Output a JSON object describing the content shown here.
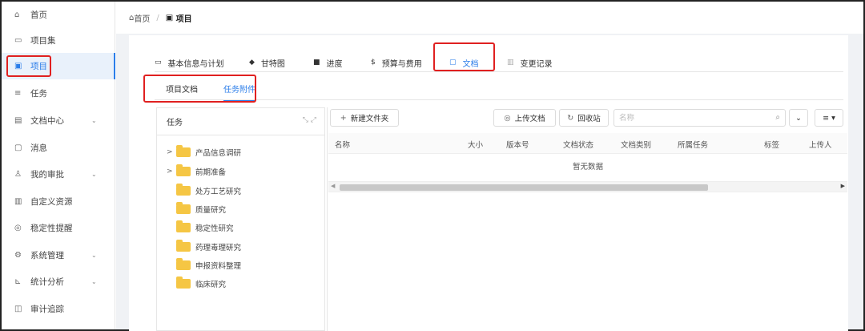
{
  "sidebar": {
    "items": [
      {
        "icon": "home-icon",
        "glyph": "⌂",
        "label": "首页"
      },
      {
        "icon": "folder-collection-icon",
        "glyph": "▭",
        "label": "项目集"
      },
      {
        "icon": "project-icon",
        "glyph": "▣",
        "label": "项目",
        "active": true
      },
      {
        "icon": "list-icon",
        "glyph": "≡",
        "label": "任务"
      },
      {
        "icon": "document-center-icon",
        "glyph": "▤",
        "label": "文档中心",
        "chevron": "⌄"
      },
      {
        "icon": "message-icon",
        "glyph": "▢",
        "label": "消息"
      },
      {
        "icon": "approval-icon",
        "glyph": "♙",
        "label": "我的审批",
        "chevron": "⌄"
      },
      {
        "icon": "custom-resource-icon",
        "glyph": "▥",
        "label": "自定义资源"
      },
      {
        "icon": "stability-reminder-icon",
        "glyph": "◎",
        "label": "稳定性提醒"
      },
      {
        "icon": "settings-icon",
        "glyph": "⚙",
        "label": "系统管理",
        "chevron": "⌄"
      },
      {
        "icon": "chart-icon",
        "glyph": "⊾",
        "label": "统计分析",
        "chevron": "⌄"
      },
      {
        "icon": "audit-icon",
        "glyph": "◫",
        "label": "审计追踪"
      }
    ]
  },
  "breadcrumb": {
    "home": "首页",
    "separator": "/",
    "current": "项目"
  },
  "tabs": [
    {
      "glyph": "▭",
      "label": "基本信息与计划"
    },
    {
      "glyph": "◆",
      "label": "甘特图"
    },
    {
      "glyph": "■",
      "label": "进度"
    },
    {
      "glyph": "$",
      "label": "预算与费用"
    },
    {
      "glyph": "▢",
      "label": "文档",
      "active": true
    },
    {
      "glyph": "▥",
      "label": "变更记录"
    }
  ],
  "subtabs": [
    {
      "label": "项目文档"
    },
    {
      "label": "任务附件",
      "active": true
    }
  ],
  "tree": {
    "title": "任务",
    "expand_glyph": "⤡ ⤢",
    "nodes": [
      {
        "label": "产品信息调研",
        "arrow": ">"
      },
      {
        "label": "前期准备",
        "arrow": ">"
      },
      {
        "label": "处方工艺研究",
        "arrow": ""
      },
      {
        "label": "质量研究",
        "arrow": ""
      },
      {
        "label": "稳定性研究",
        "arrow": ""
      },
      {
        "label": "药理毒理研究",
        "arrow": ""
      },
      {
        "label": "申报资料整理",
        "arrow": ""
      },
      {
        "label": "临床研究",
        "arrow": ""
      }
    ]
  },
  "toolbar": {
    "new_folder": "新建文件夹",
    "new_folder_glyph": "+",
    "upload": "上传文档",
    "upload_glyph": "◎",
    "recycle": "回收站",
    "recycle_glyph": "↻",
    "search_placeholder": "名称",
    "search_glyph": "⌕",
    "dropdown_glyph": "⌄",
    "view_glyph": "≡ ▾"
  },
  "table": {
    "columns": [
      "名称",
      "大小",
      "版本号",
      "文档状态",
      "文档类别",
      "所属任务",
      "标签",
      "上传人"
    ],
    "empty_text": "暂无数据"
  },
  "colors": {
    "accent": "#2b7de9",
    "highlight": "#e02020",
    "folder": "#f5c644"
  }
}
